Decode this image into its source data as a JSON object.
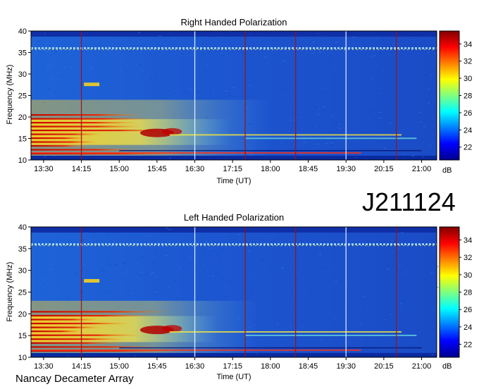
{
  "page": {
    "observation_id": "J211124",
    "credit": "Nancay Decameter Array"
  },
  "chart_data": [
    {
      "type": "heatmap",
      "title": "Right Handed Polarization",
      "xlabel": "Time (UT)",
      "ylabel": "Frequency (MHz)",
      "x_ticks": [
        "13:30",
        "14:15",
        "15:00",
        "15:45",
        "16:30",
        "17:15",
        "18:00",
        "18:45",
        "19:30",
        "20:15",
        "21:00"
      ],
      "x_range_hours": [
        13.25,
        21.3
      ],
      "y_ticks": [
        10,
        15,
        20,
        25,
        30,
        35,
        40
      ],
      "ylim": [
        10,
        40
      ],
      "colorbar": {
        "label": "dB",
        "ticks": [
          22,
          24,
          26,
          28,
          30,
          32,
          34
        ],
        "range": [
          20.5,
          35.5
        ],
        "colormap": "jet"
      },
      "features": {
        "interference_band_mhz": 36,
        "vertical_markers_ut": [
          "14:15",
          "16:30",
          "17:30",
          "18:30",
          "19:30",
          "20:30"
        ],
        "intense_emission": {
          "start_ut": "13:30",
          "end_ut": "18:00",
          "freq_range_mhz": [
            11,
            24
          ]
        }
      }
    },
    {
      "type": "heatmap",
      "title": "Left Handed Polarization",
      "xlabel": "Time (UT)",
      "ylabel": "Frequency (MHz)",
      "x_ticks": [
        "13:30",
        "14:15",
        "15:00",
        "15:45",
        "16:30",
        "17:15",
        "18:00",
        "18:45",
        "19:30",
        "20:15",
        "21:00"
      ],
      "x_range_hours": [
        13.25,
        21.3
      ],
      "y_ticks": [
        10,
        15,
        20,
        25,
        30,
        35,
        40
      ],
      "ylim": [
        10,
        40
      ],
      "colorbar": {
        "label": "dB",
        "ticks": [
          22,
          24,
          26,
          28,
          30,
          32,
          34
        ],
        "range": [
          20.5,
          35.5
        ],
        "colormap": "jet"
      },
      "features": {
        "interference_band_mhz": 36,
        "vertical_markers_ut": [
          "14:15",
          "16:30",
          "17:30",
          "18:30",
          "19:30",
          "20:30"
        ],
        "intense_emission": {
          "start_ut": "13:30",
          "end_ut": "17:45",
          "freq_range_mhz": [
            11,
            23
          ]
        }
      }
    }
  ]
}
